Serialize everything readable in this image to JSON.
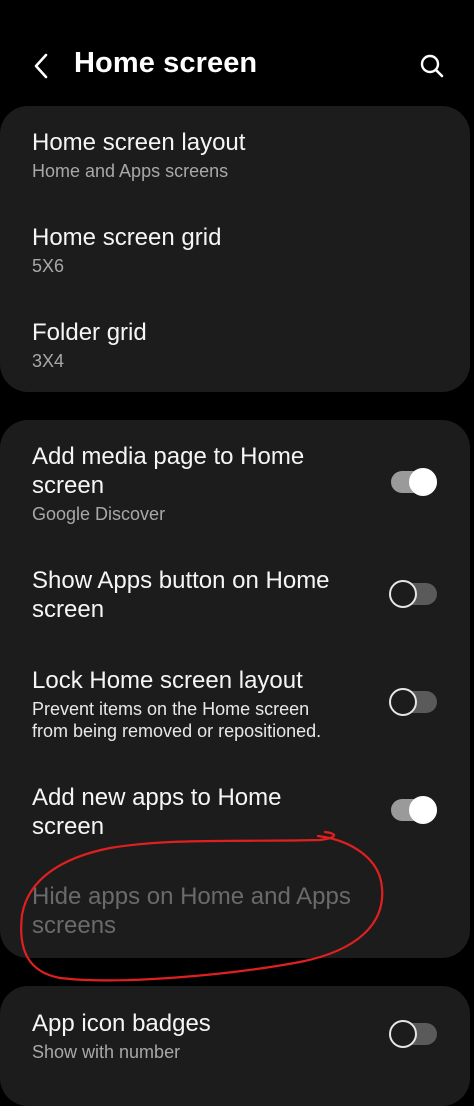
{
  "header": {
    "title": "Home screen",
    "back_icon": "chevron-left-icon",
    "search_icon": "search-icon"
  },
  "group1": [
    {
      "title": "Home screen layout",
      "subtitle": "Home and Apps screens"
    },
    {
      "title": "Home screen grid",
      "subtitle": "5X6"
    },
    {
      "title": "Folder grid",
      "subtitle": "3X4"
    }
  ],
  "group2": [
    {
      "title_line1": "Add media page to Home",
      "title_line2": "screen",
      "subtitle": "Google Discover",
      "toggle": "on"
    },
    {
      "title_line1": "Show Apps button on Home",
      "title_line2": "screen",
      "toggle": "off"
    },
    {
      "title": "Lock Home screen layout",
      "desc_line1": "Prevent items on the Home screen",
      "desc_line2": "from being removed or repositioned.",
      "toggle": "off"
    },
    {
      "title_line1": "Add new apps to Home",
      "title_line2": "screen",
      "toggle": "on"
    },
    {
      "title_line1": "Hide apps on Home and Apps",
      "title_line2": "screens",
      "state": "disabled"
    }
  ],
  "group3": [
    {
      "title": "App icon badges",
      "subtitle": "Show with number",
      "toggle": "off"
    }
  ],
  "colors": {
    "background": "#000000",
    "card": "#1c1c1c",
    "annotation": "#e02020"
  }
}
